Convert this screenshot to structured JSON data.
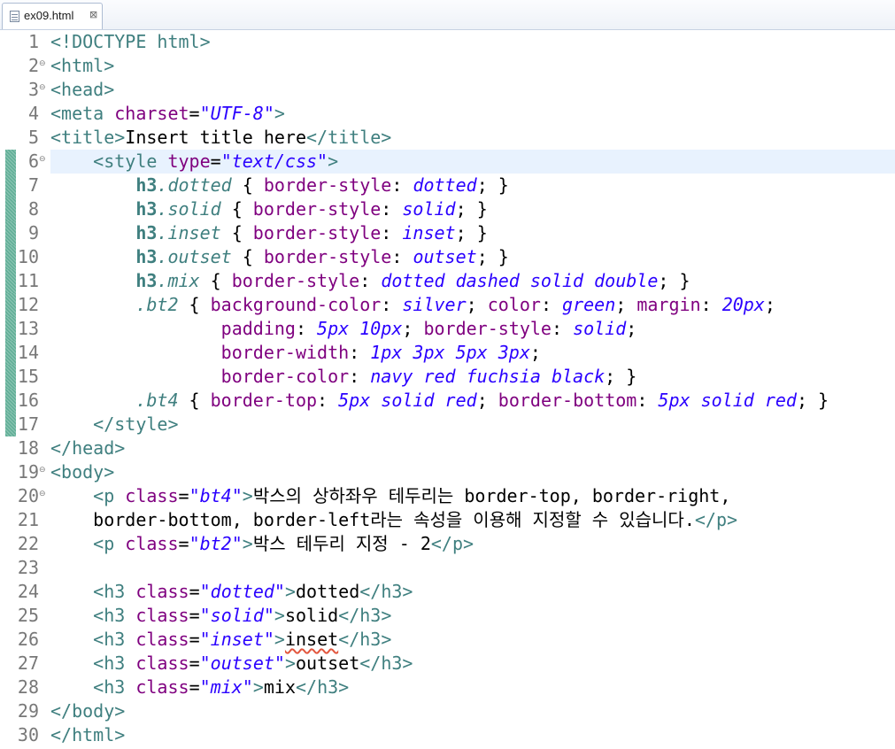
{
  "tab": {
    "label": "ex09.html",
    "close_glyph": "⊠"
  },
  "editor": {
    "fold_glyph": "⊖",
    "lines": [
      {
        "num": "1",
        "fold": false,
        "change": false,
        "tokens": [
          [
            "t",
            "<!DOCTYPE html>"
          ]
        ]
      },
      {
        "num": "2",
        "fold": true,
        "change": false,
        "tokens": [
          [
            "t",
            "<html>"
          ]
        ]
      },
      {
        "num": "3",
        "fold": true,
        "change": false,
        "tokens": [
          [
            "t",
            "<head>"
          ]
        ]
      },
      {
        "num": "4",
        "fold": false,
        "change": false,
        "tokens": [
          [
            "t",
            "<meta "
          ],
          [
            "an",
            "charset"
          ],
          [
            "pu",
            "="
          ],
          [
            "av",
            "\"UTF-8\""
          ],
          [
            "t",
            ">"
          ]
        ]
      },
      {
        "num": "5",
        "fold": false,
        "change": false,
        "tokens": [
          [
            "t",
            "<title>"
          ],
          [
            "tx",
            "Insert title here"
          ],
          [
            "t",
            "</title>"
          ]
        ]
      },
      {
        "num": "6",
        "fold": true,
        "change": true,
        "highlight": true,
        "tokens": [
          [
            "tx",
            "    "
          ],
          [
            "t",
            "<style "
          ],
          [
            "an",
            "type"
          ],
          [
            "pu",
            "="
          ],
          [
            "av",
            "\"text/css\""
          ],
          [
            "t",
            ">"
          ]
        ]
      },
      {
        "num": "7",
        "fold": false,
        "change": true,
        "tokens": [
          [
            "tx",
            "        "
          ],
          [
            "sel",
            "h3"
          ],
          [
            "cls",
            ".dotted"
          ],
          [
            "pu",
            " { "
          ],
          [
            "pn",
            "border-style"
          ],
          [
            "pu",
            ": "
          ],
          [
            "pv",
            "dotted"
          ],
          [
            "pu",
            "; }"
          ]
        ]
      },
      {
        "num": "8",
        "fold": false,
        "change": true,
        "tokens": [
          [
            "tx",
            "        "
          ],
          [
            "sel",
            "h3"
          ],
          [
            "cls",
            ".solid"
          ],
          [
            "pu",
            " { "
          ],
          [
            "pn",
            "border-style"
          ],
          [
            "pu",
            ": "
          ],
          [
            "pv",
            "solid"
          ],
          [
            "pu",
            "; }"
          ]
        ]
      },
      {
        "num": "9",
        "fold": false,
        "change": true,
        "tokens": [
          [
            "tx",
            "        "
          ],
          [
            "sel",
            "h3"
          ],
          [
            "cls",
            ".inset"
          ],
          [
            "pu",
            " { "
          ],
          [
            "pn",
            "border-style"
          ],
          [
            "pu",
            ": "
          ],
          [
            "pv",
            "inset"
          ],
          [
            "pu",
            "; }"
          ]
        ]
      },
      {
        "num": "10",
        "fold": false,
        "change": true,
        "tokens": [
          [
            "tx",
            "        "
          ],
          [
            "sel",
            "h3"
          ],
          [
            "cls",
            ".outset"
          ],
          [
            "pu",
            " { "
          ],
          [
            "pn",
            "border-style"
          ],
          [
            "pu",
            ": "
          ],
          [
            "pv",
            "outset"
          ],
          [
            "pu",
            "; }"
          ]
        ]
      },
      {
        "num": "11",
        "fold": false,
        "change": true,
        "tokens": [
          [
            "tx",
            "        "
          ],
          [
            "sel",
            "h3"
          ],
          [
            "cls",
            ".mix"
          ],
          [
            "pu",
            " { "
          ],
          [
            "pn",
            "border-style"
          ],
          [
            "pu",
            ": "
          ],
          [
            "pv",
            "dotted dashed solid double"
          ],
          [
            "pu",
            "; }"
          ]
        ]
      },
      {
        "num": "12",
        "fold": false,
        "change": true,
        "tokens": [
          [
            "tx",
            "        "
          ],
          [
            "cls",
            ".bt2"
          ],
          [
            "pu",
            " { "
          ],
          [
            "pn",
            "background-color"
          ],
          [
            "pu",
            ": "
          ],
          [
            "pv",
            "silver"
          ],
          [
            "pu",
            "; "
          ],
          [
            "pn",
            "color"
          ],
          [
            "pu",
            ": "
          ],
          [
            "pv",
            "green"
          ],
          [
            "pu",
            "; "
          ],
          [
            "pn",
            "margin"
          ],
          [
            "pu",
            ": "
          ],
          [
            "pv",
            "20px"
          ],
          [
            "pu",
            ";"
          ]
        ]
      },
      {
        "num": "13",
        "fold": false,
        "change": true,
        "tokens": [
          [
            "tx",
            "                "
          ],
          [
            "pn",
            "padding"
          ],
          [
            "pu",
            ": "
          ],
          [
            "pv",
            "5px 10px"
          ],
          [
            "pu",
            "; "
          ],
          [
            "pn",
            "border-style"
          ],
          [
            "pu",
            ": "
          ],
          [
            "pv",
            "solid"
          ],
          [
            "pu",
            ";"
          ]
        ]
      },
      {
        "num": "14",
        "fold": false,
        "change": true,
        "tokens": [
          [
            "tx",
            "                "
          ],
          [
            "pn",
            "border-width"
          ],
          [
            "pu",
            ": "
          ],
          [
            "pv",
            "1px 3px 5px 3px"
          ],
          [
            "pu",
            ";"
          ]
        ]
      },
      {
        "num": "15",
        "fold": false,
        "change": true,
        "tokens": [
          [
            "tx",
            "                "
          ],
          [
            "pn",
            "border-color"
          ],
          [
            "pu",
            ": "
          ],
          [
            "pv",
            "navy red fuchsia black"
          ],
          [
            "pu",
            "; }"
          ]
        ]
      },
      {
        "num": "16",
        "fold": false,
        "change": true,
        "tokens": [
          [
            "tx",
            "        "
          ],
          [
            "cls",
            ".bt4"
          ],
          [
            "pu",
            " { "
          ],
          [
            "pn",
            "border-top"
          ],
          [
            "pu",
            ": "
          ],
          [
            "pv",
            "5px solid red"
          ],
          [
            "pu",
            "; "
          ],
          [
            "pn",
            "border-bottom"
          ],
          [
            "pu",
            ": "
          ],
          [
            "pv",
            "5px solid red"
          ],
          [
            "pu",
            "; }"
          ]
        ]
      },
      {
        "num": "17",
        "fold": false,
        "change": true,
        "tokens": [
          [
            "tx",
            "    "
          ],
          [
            "t",
            "</style>"
          ]
        ]
      },
      {
        "num": "18",
        "fold": false,
        "change": false,
        "tokens": [
          [
            "t",
            "</head>"
          ]
        ]
      },
      {
        "num": "19",
        "fold": true,
        "change": false,
        "tokens": [
          [
            "t",
            "<body>"
          ]
        ]
      },
      {
        "num": "20",
        "fold": true,
        "change": false,
        "tokens": [
          [
            "tx",
            "    "
          ],
          [
            "t",
            "<p "
          ],
          [
            "an",
            "class"
          ],
          [
            "pu",
            "="
          ],
          [
            "av",
            "\"bt4\""
          ],
          [
            "t",
            ">"
          ],
          [
            "tx",
            "박스의 상하좌우 테두리는 border-top, border-right,"
          ]
        ]
      },
      {
        "num": "21",
        "fold": false,
        "change": false,
        "tokens": [
          [
            "tx",
            "    border-bottom, border-left라는 속성을 이용해 지정할 수 있습니다."
          ],
          [
            "t",
            "</p>"
          ]
        ]
      },
      {
        "num": "22",
        "fold": false,
        "change": false,
        "tokens": [
          [
            "tx",
            "    "
          ],
          [
            "t",
            "<p "
          ],
          [
            "an",
            "class"
          ],
          [
            "pu",
            "="
          ],
          [
            "av",
            "\"bt2\""
          ],
          [
            "t",
            ">"
          ],
          [
            "tx",
            "박스 테두리 지정 - 2"
          ],
          [
            "t",
            "</p>"
          ]
        ]
      },
      {
        "num": "23",
        "fold": false,
        "change": false,
        "tokens": []
      },
      {
        "num": "24",
        "fold": false,
        "change": false,
        "tokens": [
          [
            "tx",
            "    "
          ],
          [
            "t",
            "<h3 "
          ],
          [
            "an",
            "class"
          ],
          [
            "pu",
            "="
          ],
          [
            "av",
            "\"dotted\""
          ],
          [
            "t",
            ">"
          ],
          [
            "tx",
            "dotted"
          ],
          [
            "t",
            "</h3>"
          ]
        ]
      },
      {
        "num": "25",
        "fold": false,
        "change": false,
        "tokens": [
          [
            "tx",
            "    "
          ],
          [
            "t",
            "<h3 "
          ],
          [
            "an",
            "class"
          ],
          [
            "pu",
            "="
          ],
          [
            "av",
            "\"solid\""
          ],
          [
            "t",
            ">"
          ],
          [
            "tx",
            "solid"
          ],
          [
            "t",
            "</h3>"
          ]
        ]
      },
      {
        "num": "26",
        "fold": false,
        "change": false,
        "tokens": [
          [
            "tx",
            "    "
          ],
          [
            "t",
            "<h3 "
          ],
          [
            "an",
            "class"
          ],
          [
            "pu",
            "="
          ],
          [
            "av",
            "\"inset\""
          ],
          [
            "t",
            ">"
          ],
          [
            "sq",
            "inset"
          ],
          [
            "t",
            "</h3>"
          ]
        ]
      },
      {
        "num": "27",
        "fold": false,
        "change": false,
        "tokens": [
          [
            "tx",
            "    "
          ],
          [
            "t",
            "<h3 "
          ],
          [
            "an",
            "class"
          ],
          [
            "pu",
            "="
          ],
          [
            "av",
            "\"outset\""
          ],
          [
            "t",
            ">"
          ],
          [
            "tx",
            "outset"
          ],
          [
            "t",
            "</h3>"
          ]
        ]
      },
      {
        "num": "28",
        "fold": false,
        "change": false,
        "tokens": [
          [
            "tx",
            "    "
          ],
          [
            "t",
            "<h3 "
          ],
          [
            "an",
            "class"
          ],
          [
            "pu",
            "="
          ],
          [
            "av",
            "\"mix\""
          ],
          [
            "t",
            ">"
          ],
          [
            "tx",
            "mix"
          ],
          [
            "t",
            "</h3>"
          ]
        ]
      },
      {
        "num": "29",
        "fold": false,
        "change": false,
        "tokens": [
          [
            "t",
            "</body>"
          ]
        ]
      },
      {
        "num": "30",
        "fold": false,
        "change": false,
        "tokens": [
          [
            "t",
            "</html>"
          ]
        ]
      }
    ]
  }
}
